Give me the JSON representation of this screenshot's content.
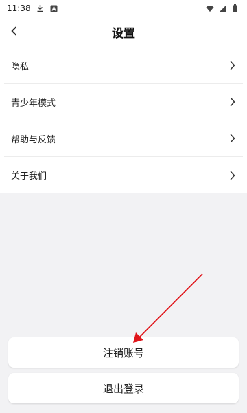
{
  "status_bar": {
    "time": "11:38",
    "left_icons": [
      "download-icon",
      "a-box-icon"
    ],
    "right_icons": [
      "wifi-icon",
      "signal-icon",
      "battery-icon"
    ]
  },
  "header": {
    "back_icon": "chevron-left-icon",
    "title": "设置"
  },
  "settings": {
    "items": [
      {
        "label": "隐私"
      },
      {
        "label": "青少年模式"
      },
      {
        "label": "帮助与反馈"
      },
      {
        "label": "关于我们"
      }
    ]
  },
  "actions": {
    "cancel_account_label": "注销账号",
    "logout_label": "退出登录"
  },
  "colors": {
    "background": "#f2f2f4",
    "surface": "#ffffff",
    "annotation_arrow": "#e0161b"
  }
}
